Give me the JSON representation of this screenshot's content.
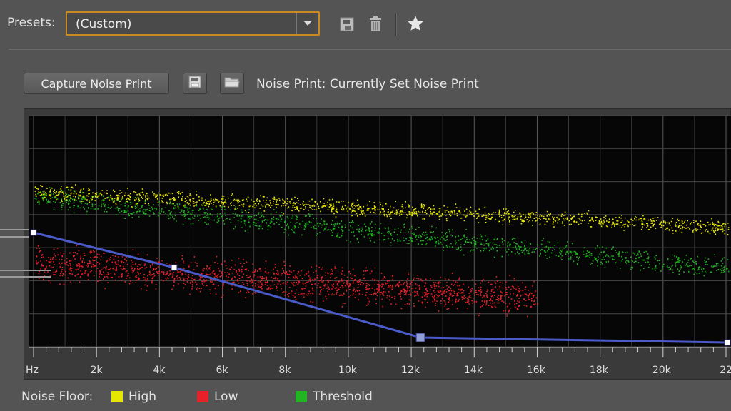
{
  "presets": {
    "label": "Presets:",
    "selected": "(Custom)",
    "icons": [
      "save-preset-icon",
      "delete-icon",
      "favorite-star-icon"
    ]
  },
  "noise_print": {
    "capture_label": "Capture Noise Print",
    "icons": [
      "save-icon",
      "open-folder-icon"
    ],
    "label": "Noise Print:",
    "value": "Currently Set Noise Print"
  },
  "graph": {
    "x_ticks": [
      "Hz",
      "2k",
      "4k",
      "6k",
      "8k",
      "10k",
      "12k",
      "14k",
      "16k",
      "18k",
      "20k",
      "22"
    ],
    "x_tick_values": [
      0,
      2000,
      4000,
      6000,
      8000,
      10000,
      12000,
      14000,
      16000,
      18000,
      20000,
      22050
    ]
  },
  "legend": {
    "label": "Noise Floor:",
    "items": [
      {
        "label": "High",
        "color": "#e6e600"
      },
      {
        "label": "Low",
        "color": "#e8202a"
      },
      {
        "label": "Threshold",
        "color": "#22b422"
      }
    ]
  },
  "colors": {
    "accent_border": "#c98a22",
    "curve": "#4a5ac8",
    "high": "#e6e600",
    "low": "#e8202a",
    "threshold": "#22b422"
  }
}
